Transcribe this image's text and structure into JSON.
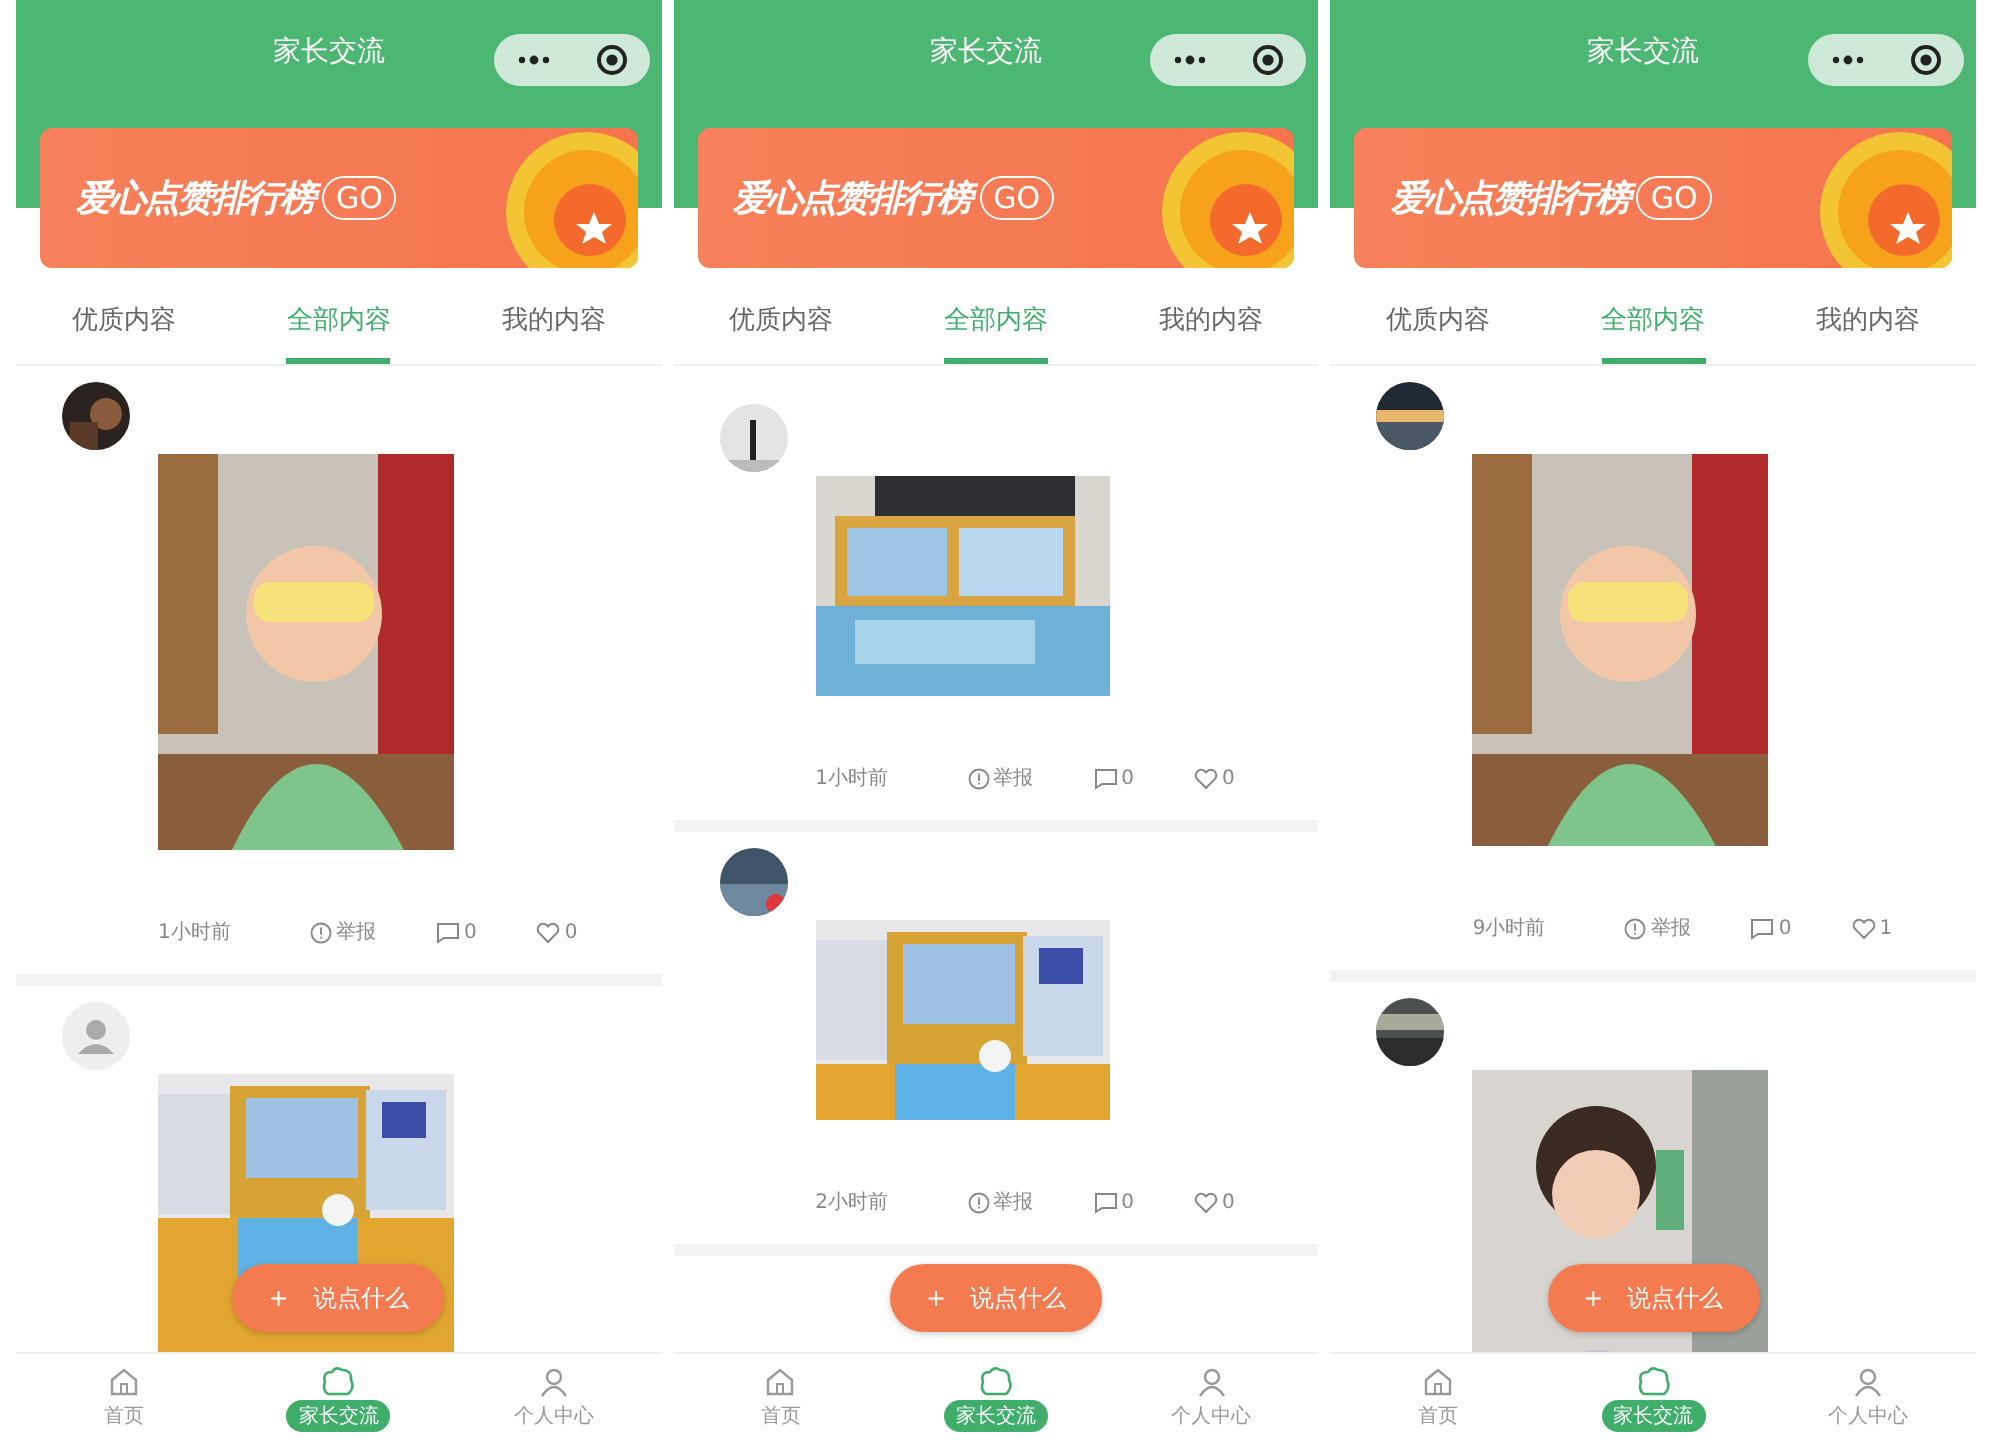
{
  "screens": [
    {
      "header": {
        "title": "家长交流"
      },
      "banner": {
        "title": "爱心点赞排行榜",
        "button": "GO"
      },
      "tabs": [
        {
          "label": "优质内容",
          "selected": false
        },
        {
          "label": "全部内容",
          "selected": true
        },
        {
          "label": "我的内容",
          "selected": false
        }
      ],
      "posts": [
        {
          "avatar": {
            "kind": "picture"
          },
          "photo": {
            "kind": "picture"
          },
          "meta": {
            "time": "1小时前",
            "report": "举报",
            "comments": "0",
            "likes": "0"
          }
        },
        {
          "avatar": {
            "kind": "default"
          },
          "photo": {
            "kind": "picture"
          }
        }
      ],
      "fab": {
        "icon": "+",
        "label": "说点什么"
      },
      "nav": [
        {
          "label": "首页",
          "kind": "home",
          "selected": false
        },
        {
          "label": "家长交流",
          "kind": "chat",
          "selected": true
        },
        {
          "label": "个人中心",
          "kind": "person",
          "selected": false
        }
      ]
    },
    {
      "header": {
        "title": "家长交流"
      },
      "banner": {
        "title": "爱心点赞排行榜",
        "button": "GO"
      },
      "tabs": [
        {
          "label": "优质内容",
          "selected": false
        },
        {
          "label": "全部内容",
          "selected": true
        },
        {
          "label": "我的内容",
          "selected": false
        }
      ],
      "posts": [
        {
          "avatar": {
            "kind": "picture"
          },
          "photo": {
            "kind": "picture"
          },
          "meta": {
            "time": "1小时前",
            "report": "举报",
            "comments": "0",
            "likes": "0"
          }
        },
        {
          "avatar": {
            "kind": "picture"
          },
          "photo": {
            "kind": "picture"
          },
          "meta": {
            "time": "2小时前",
            "report": "举报",
            "comments": "0",
            "likes": "0"
          }
        }
      ],
      "fab": {
        "icon": "+",
        "label": "说点什么"
      },
      "nav": [
        {
          "label": "首页",
          "kind": "home",
          "selected": false
        },
        {
          "label": "家长交流",
          "kind": "chat",
          "selected": true
        },
        {
          "label": "个人中心",
          "kind": "person",
          "selected": false
        }
      ]
    },
    {
      "header": {
        "title": "家长交流"
      },
      "banner": {
        "title": "爱心点赞排行榜",
        "button": "GO"
      },
      "tabs": [
        {
          "label": "优质内容",
          "selected": false
        },
        {
          "label": "全部内容",
          "selected": true
        },
        {
          "label": "我的内容",
          "selected": false
        }
      ],
      "posts": [
        {
          "avatar": {
            "kind": "picture"
          },
          "photo": {
            "kind": "picture"
          },
          "meta": {
            "time": "9小时前",
            "report": "举报",
            "comments": "0",
            "likes": "1"
          }
        },
        {
          "avatar": {
            "kind": "picture"
          },
          "photo": {
            "kind": "picture"
          }
        }
      ],
      "fab": {
        "icon": "+",
        "label": "说点什么"
      },
      "nav": [
        {
          "label": "首页",
          "kind": "home",
          "selected": false
        },
        {
          "label": "家长交流",
          "kind": "chat",
          "selected": true
        },
        {
          "label": "个人中心",
          "kind": "person",
          "selected": false
        }
      ]
    }
  ]
}
